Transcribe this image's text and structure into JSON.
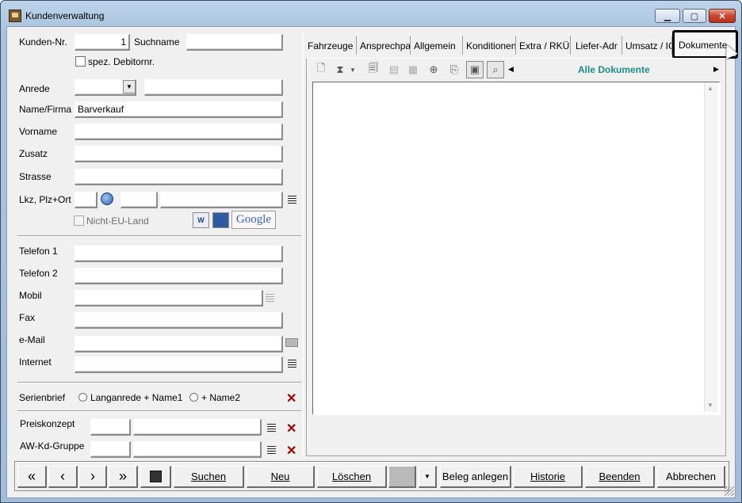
{
  "window": {
    "title": "Kundenverwaltung",
    "minimize": "▁",
    "maximize": "▢",
    "close": "✕"
  },
  "form": {
    "kunden_nr_label": "Kunden-Nr.",
    "kunden_nr_value": "1",
    "suchname_label": "Suchname",
    "suchname_value": "",
    "spez_debitor_label": "spez. Debitornr.",
    "anrede_label": "Anrede",
    "name_firma_label": "Name/Firma",
    "name_firma_value": "Barverkauf",
    "vorname_label": "Vorname",
    "zusatz_label": "Zusatz",
    "strasse_label": "Strasse",
    "lkz_label": "Lkz, Plz+Ort",
    "nicht_eu_label": "Nicht-EU-Land",
    "google_label": "Google",
    "telefon1_label": "Telefon 1",
    "telefon2_label": "Telefon 2",
    "mobil_label": "Mobil",
    "fax_label": "Fax",
    "email_label": "e-Mail",
    "internet_label": "Internet",
    "serienbrief_label": "Serienbrief",
    "radio1_label": "Langanrede + Name1",
    "radio2_label": "+ Name2",
    "preiskonzept_label": "Preiskonzept",
    "awkd_label": "AW-Kd-Gruppe"
  },
  "tabs": [
    {
      "label": "Fahrzeuge"
    },
    {
      "label": "Ansprechpa"
    },
    {
      "label": "Allgemein"
    },
    {
      "label": "Konditionen"
    },
    {
      "label": "Extra / RKÜ"
    },
    {
      "label": "Liefer-Adr"
    },
    {
      "label": "Umsatz / IC"
    },
    {
      "label": "Dokumente"
    }
  ],
  "documents": {
    "filter_label": "Alle Dokumente",
    "accent": "#1e8c8c"
  },
  "buttons": {
    "first": "«",
    "prev": "‹",
    "next": "›",
    "last": "»",
    "suchen": "Suchen",
    "neu": "Neu",
    "loeschen": "Löschen",
    "beleg": "Beleg anlegen",
    "historie": "Historie",
    "beenden": "Beenden",
    "abbrechen": "Abbrechen"
  }
}
